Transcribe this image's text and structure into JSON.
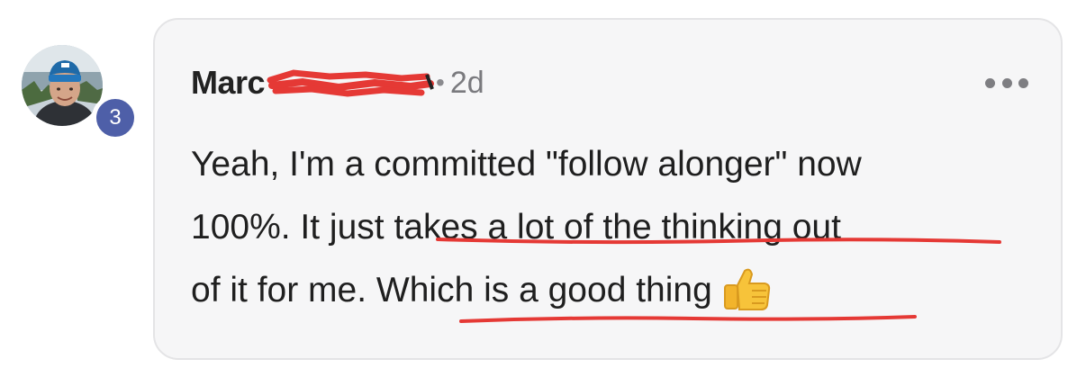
{
  "avatar": {
    "icon": "user-avatar-photo",
    "badge_count": "3",
    "badge_color": "#4e5fa8"
  },
  "comment": {
    "author": "Marc",
    "separator": "•",
    "timestamp": "2d",
    "more_icon": "more-horizontal-icon",
    "text": {
      "line_1": "Yeah, I'm a committed \"follow alonger\" now",
      "line_2_prefix": "100%. It just ",
      "highlight_1": "takes a lot of the thinking out",
      "line_3_prefix": "of it for me. ",
      "highlight_2": "Which is a good thing"
    },
    "emoji": "thumbs-up-icon"
  },
  "colors": {
    "card_background": "#f6f6f7",
    "annotation_red": "#e53935",
    "text": "#1f1f1f",
    "muted": "#7a7a7e"
  }
}
